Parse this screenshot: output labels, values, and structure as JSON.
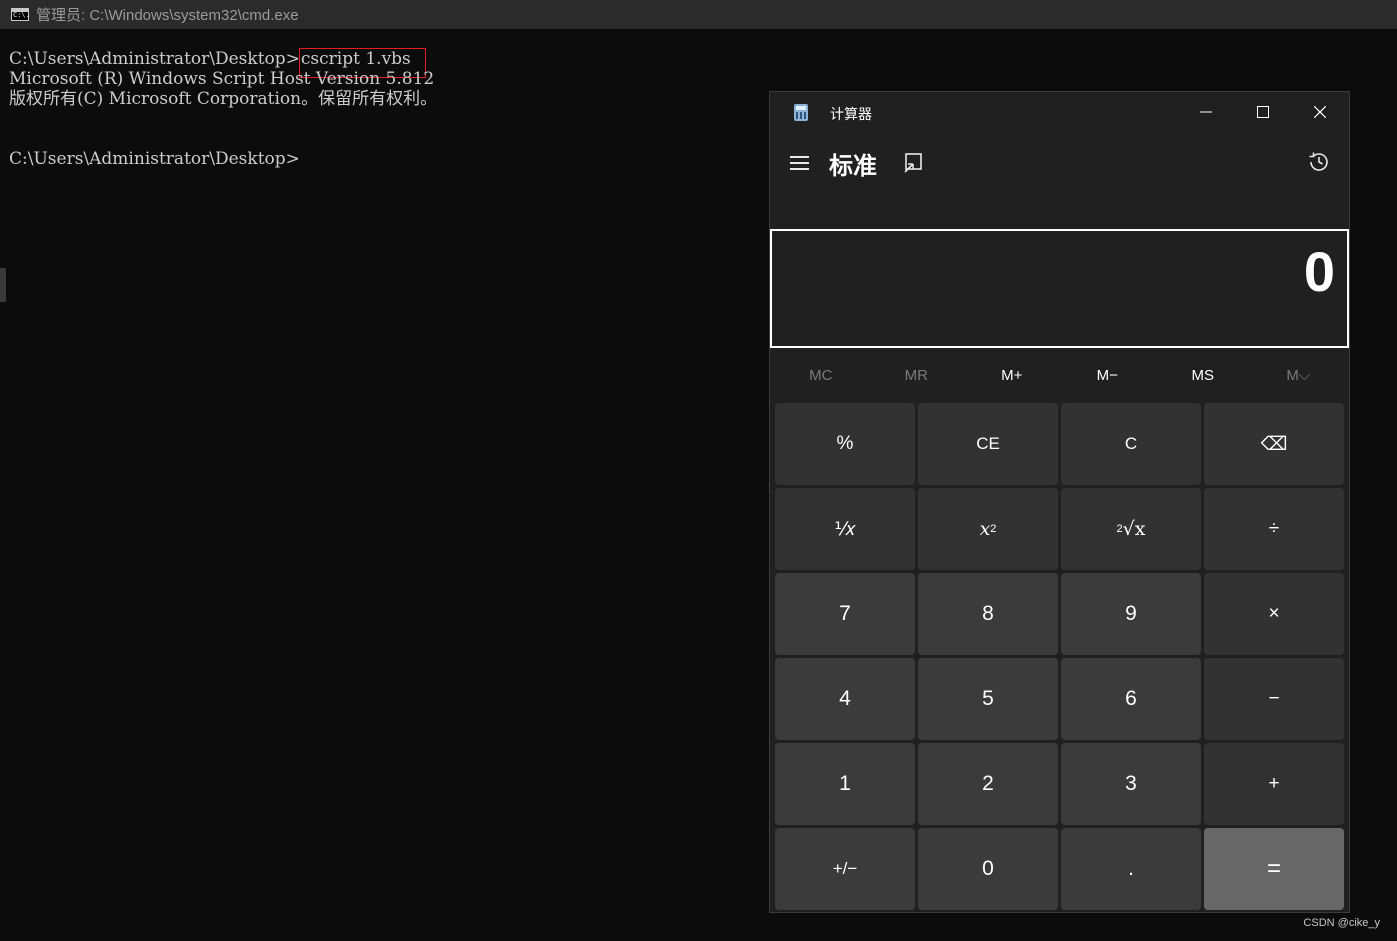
{
  "cmd": {
    "title": "管理员: C:\\Windows\\system32\\cmd.exe",
    "icon_text": "C:\\.",
    "prompt": "C:\\Users\\Administrator\\Desktop>",
    "command": "cscript 1.vbs",
    "line2": "Microsoft (R) Windows Script Host Version 5.812",
    "line3": "版权所有(C) Microsoft Corporation。保留所有权利。",
    "line5": "C:\\Users\\Administrator\\Desktop>"
  },
  "calculator": {
    "title": "计算器",
    "mode": "标准",
    "display_value": "0",
    "memory": {
      "mc": "MC",
      "mr": "MR",
      "mplus": "M+",
      "mminus": "M−",
      "ms": "MS",
      "mlist": "M⌵"
    },
    "keys": {
      "percent": "%",
      "ce": "CE",
      "c": "C",
      "backspace": "⌫",
      "reciprocal": "⅟𝑥",
      "square_base": "x",
      "square_exp": "2",
      "sqrt_index": "2",
      "sqrt_body": "√x",
      "divide": "÷",
      "n7": "7",
      "n8": "8",
      "n9": "9",
      "multiply": "×",
      "n4": "4",
      "n5": "5",
      "n6": "6",
      "minus": "−",
      "n1": "1",
      "n2": "2",
      "n3": "3",
      "plus": "+",
      "negate": "+/−",
      "n0": "0",
      "decimal": ".",
      "equals": "="
    }
  },
  "watermark": "CSDN @cike_y"
}
